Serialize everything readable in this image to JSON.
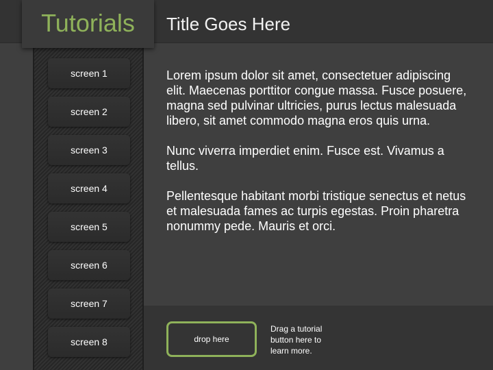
{
  "header": {
    "logo_text": "Tutorials",
    "title": "Title Goes Here"
  },
  "sidebar": {
    "items": [
      {
        "label": "screen 1"
      },
      {
        "label": "screen 2"
      },
      {
        "label": "screen 3"
      },
      {
        "label": "screen 4"
      },
      {
        "label": "screen 5"
      },
      {
        "label": "screen 6"
      },
      {
        "label": "screen 7"
      },
      {
        "label": "screen 8"
      }
    ]
  },
  "content": {
    "paragraphs": [
      "Lorem ipsum dolor sit amet, consectetuer adipiscing elit. Maecenas porttitor congue massa. Fusce posuere, magna sed pulvinar ultricies, purus lectus malesuada libero, sit amet commodo magna eros quis urna.",
      "Nunc viverra imperdiet enim. Fusce est. Vivamus a tellus.",
      "Pellentesque habitant morbi tristique senectus et netus et malesuada fames ac turpis egestas. Proin pharetra nonummy pede. Mauris et orci."
    ]
  },
  "dropzone": {
    "label": "drop here",
    "hint": "Drag a tutorial button here to learn more."
  },
  "colors": {
    "accent": "#8fb25a",
    "background": "#3f3f3f",
    "header": "#333333",
    "sidebar": "#2b2b2b"
  }
}
